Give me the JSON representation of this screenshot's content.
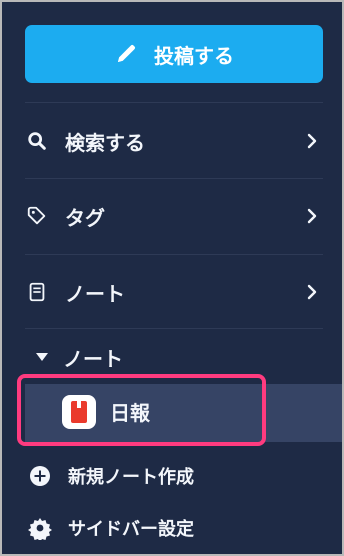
{
  "sidebar": {
    "post_button": {
      "label": "投稿する",
      "icon": "pencil-icon"
    },
    "menu": [
      {
        "label": "検索する",
        "icon": "search-icon"
      },
      {
        "label": "タグ",
        "icon": "tag-icon"
      },
      {
        "label": "ノート",
        "icon": "book-icon"
      }
    ],
    "section": {
      "label": "ノート",
      "icon": "caret-down-icon"
    },
    "selected_note": {
      "label": "日報",
      "icon": "red-book-icon"
    },
    "bottom": [
      {
        "label": "新規ノート作成",
        "icon": "plus-circle-icon"
      },
      {
        "label": "サイドバー設定",
        "icon": "gear-icon"
      }
    ],
    "colors": {
      "background": "#1e2a45",
      "accent": "#1cacf0",
      "highlight": "#ff3b7f"
    }
  }
}
